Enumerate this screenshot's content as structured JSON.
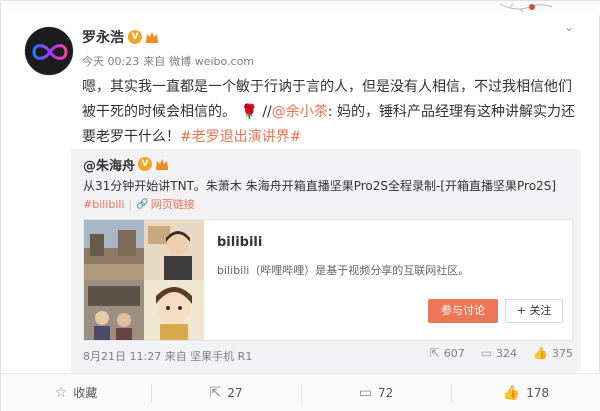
{
  "post": {
    "author": "罗永浩",
    "verified_badge": "V",
    "time": "今天 00:23",
    "source_prefix": "来自",
    "source": "微博 weibo.com",
    "text_1": "嗯，其实我一直都是一个敏于行讷于言的人，但是没有人相信，不过我相信他们被干死的时候会相信的。",
    "rose": "🌹",
    "text_2": " //",
    "mention": "@余小茶",
    "text_3": ": 妈的，锤科产品经理有这种讲解实力还要老罗干什么！",
    "hashtag": "#老罗退出演讲界#"
  },
  "repost": {
    "author": "@朱海舟",
    "verified_badge": "V",
    "text": "从31分钟开始讲TNT。朱萧木 朱海舟开箱直播坚果Pro2S全程录制-[开箱直播坚果Pro2S]",
    "tag": "#bilibili",
    "link_label": "网页链接",
    "card": {
      "title": "bilibili",
      "description": "bilibili（哔哩哔哩）是基于视频分享的互联网社区。",
      "discuss_button": "参与讨论",
      "follow_button": "+ 关注"
    },
    "footer": "8月21日 11:27 来自 坚果手机 R1",
    "reposts": "607",
    "comments": "324",
    "likes": "375"
  },
  "actions": {
    "favorite": "收藏",
    "repost": "27",
    "comment": "72",
    "like": "178"
  },
  "colors": {
    "accent": "#eb7350",
    "badge": "#f2a623"
  }
}
